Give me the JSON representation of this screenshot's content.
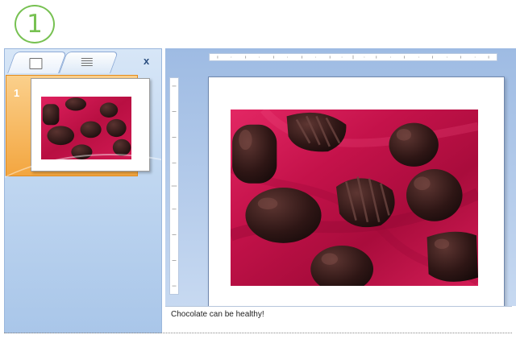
{
  "step_callout": "1",
  "left_pane": {
    "tabs": [
      {
        "name": "slides-tab",
        "icon": "slides-icon"
      },
      {
        "name": "outline-tab",
        "icon": "outline-icon"
      }
    ],
    "close_label": "x",
    "thumbnails": [
      {
        "number": "1",
        "selected": true
      }
    ]
  },
  "notes": {
    "text": "Chocolate can be healthy!"
  },
  "colors": {
    "selection": "#f3a640",
    "pane_blue": "#c2d8f1",
    "callout_green": "#77c152",
    "cloth": "#c8134a"
  }
}
